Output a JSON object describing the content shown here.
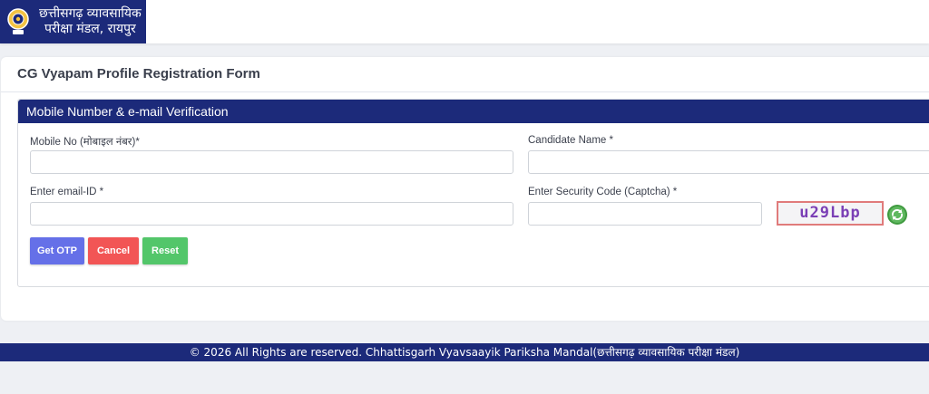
{
  "header": {
    "brand_line1": "छत्तीसगढ़ व्यावसायिक",
    "brand_line2": "परीक्षा मंडल, रायपुर"
  },
  "page": {
    "title": "CG Vyapam Profile Registration Form"
  },
  "panel": {
    "heading": "Mobile Number & e-mail Verification"
  },
  "form": {
    "mobile_label": "Mobile No (मोबाइल नंबर)*",
    "mobile_value": "",
    "name_label": "Candidate Name *",
    "name_value": "",
    "email_label": "Enter email-ID *",
    "email_value": "",
    "captcha_label": "Enter Security Code (Captcha) *",
    "captcha_value": "",
    "captcha_code": "u29Lbp"
  },
  "buttons": {
    "get_otp": "Get OTP",
    "cancel": "Cancel",
    "reset": "Reset"
  },
  "footer": {
    "text": "© 2026 All Rights are reserved. Chhattisgarh Vyavsaayik Pariksha Mandal(छत्तीसगढ़ व्यावसायिक परीक्षा मंडल)"
  },
  "colors": {
    "primary_navy": "#1c2a7a",
    "otp_button": "#6570e8",
    "cancel_button": "#f25555",
    "reset_button": "#53c66a",
    "refresh_icon": "#3f9a3f"
  },
  "icons": {
    "logo": "emblem-logo-icon",
    "refresh": "refresh-icon"
  }
}
